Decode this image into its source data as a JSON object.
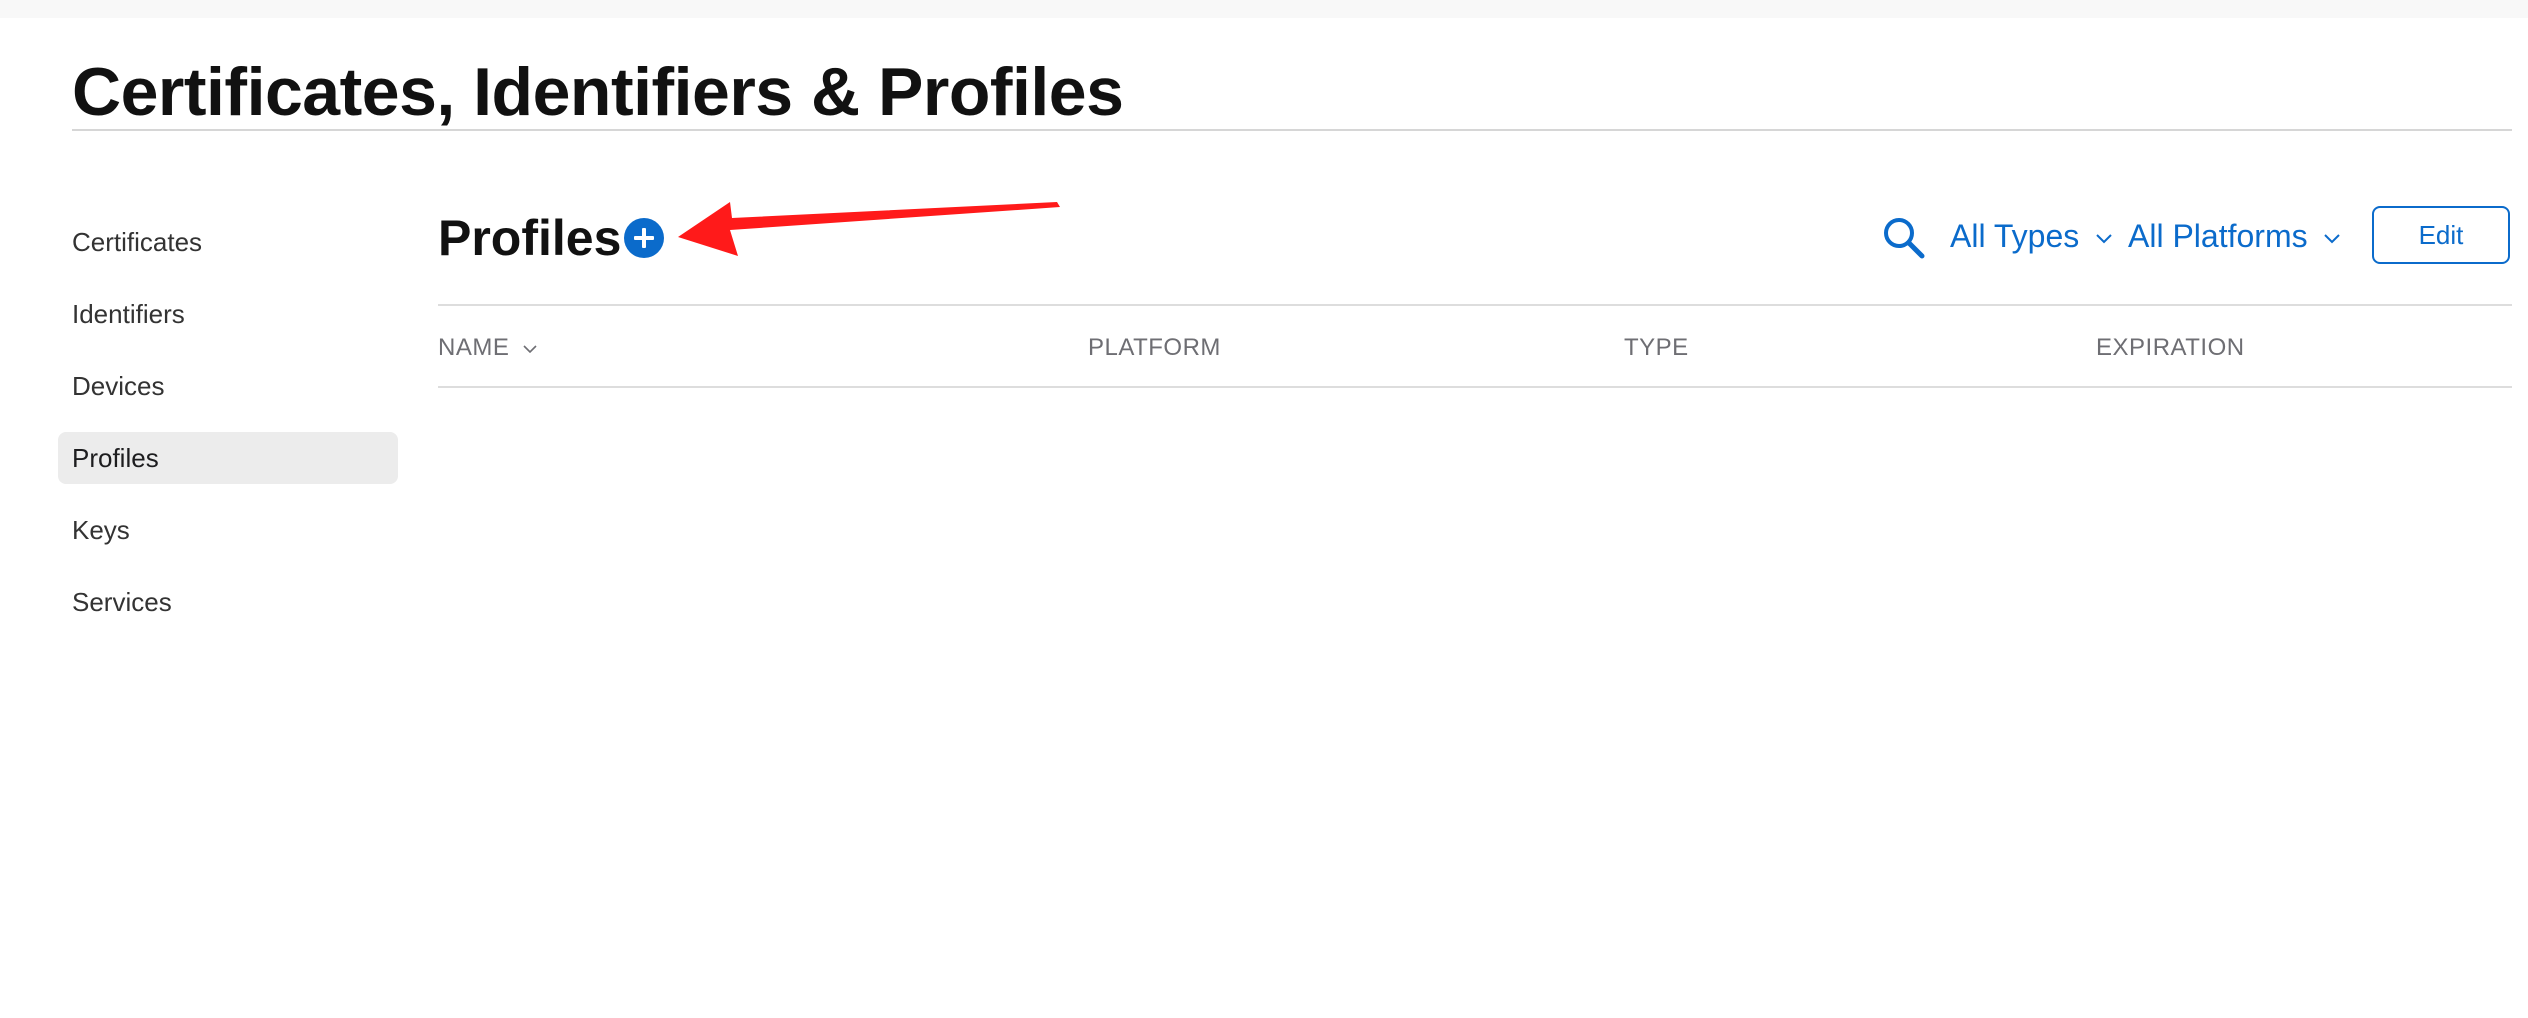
{
  "page": {
    "title": "Certificates, Identifiers & Profiles"
  },
  "sidebar": {
    "items": [
      {
        "label": "Certificates",
        "active": false
      },
      {
        "label": "Identifiers",
        "active": false
      },
      {
        "label": "Devices",
        "active": false
      },
      {
        "label": "Profiles",
        "active": true
      },
      {
        "label": "Keys",
        "active": false
      },
      {
        "label": "Services",
        "active": false
      }
    ]
  },
  "main": {
    "section_title": "Profiles",
    "add_icon": "plus-circle-icon",
    "annotation": "red-arrow-pointing-to-add-button",
    "toolbar": {
      "search_icon": "search-icon",
      "type_filter": "All Types",
      "platform_filter": "All Platforms",
      "edit_label": "Edit"
    },
    "table": {
      "columns": [
        "NAME",
        "PLATFORM",
        "TYPE",
        "EXPIRATION"
      ],
      "sorted_by": "NAME",
      "rows": []
    }
  },
  "colors": {
    "accent": "#0b6bcb",
    "annotation": "#ff1a1a",
    "active_nav_bg": "#ececec",
    "rule": "#dddddd"
  }
}
